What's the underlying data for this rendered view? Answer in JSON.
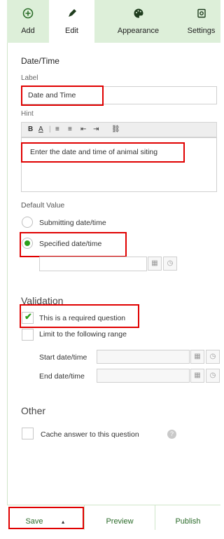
{
  "toolbar": {
    "add": {
      "label": "Add",
      "icon": "plus-circle-icon"
    },
    "edit": {
      "label": "Edit",
      "icon": "pencil-icon"
    },
    "appearance": {
      "label": "Appearance",
      "icon": "palette-icon"
    },
    "settings": {
      "label": "Settings",
      "icon": "settings-icon"
    }
  },
  "section_title": "Date/Time",
  "label_field": {
    "label": "Label",
    "value": "Date and Time"
  },
  "hint_field": {
    "label": "Hint",
    "format_buttons": [
      "B",
      "A",
      "|",
      "≡",
      "≡",
      "⇤",
      "⇥",
      "⛓"
    ],
    "value": "Enter the date and time of animal siting"
  },
  "default_value": {
    "label": "Default Value",
    "options": [
      "Submitting date/time",
      "Specified date/time"
    ],
    "selected": "Specified date/time"
  },
  "validation": {
    "heading": "Validation",
    "required_label": "This is a required question",
    "required_checked": true,
    "range_label": "Limit to the following range",
    "start_label": "Start date/time",
    "end_label": "End date/time"
  },
  "other": {
    "heading": "Other",
    "cache_label": "Cache answer to this question"
  },
  "footer": {
    "save": "Save",
    "preview": "Preview",
    "publish": "Publish"
  },
  "colors": {
    "accent": "#2ca01c",
    "toolbar_bg": "#ddefd9",
    "highlight": "#e00000"
  }
}
